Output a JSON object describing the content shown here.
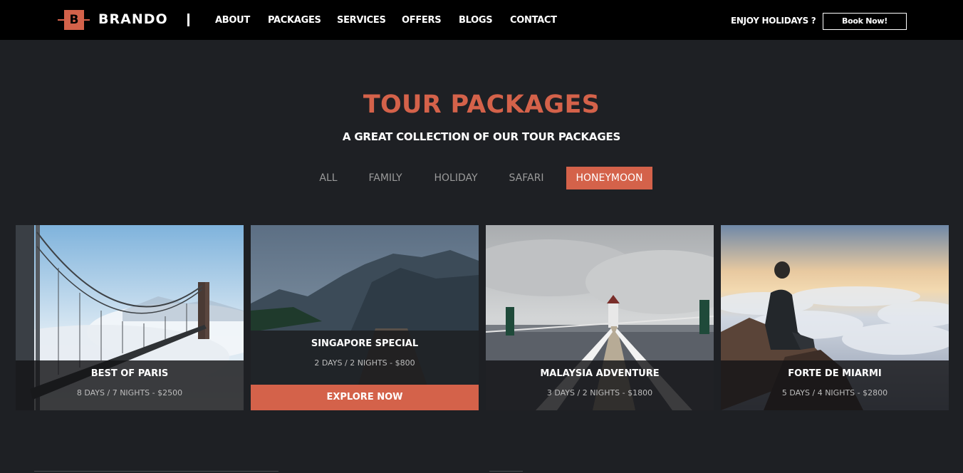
{
  "brand": {
    "mark": "B",
    "name": "BRANDO"
  },
  "nav": {
    "items": [
      "ABOUT",
      "PACKAGES",
      "SERVICES",
      "OFFERS",
      "BLOGS",
      "CONTACT"
    ],
    "tagline": "ENJOY HOLIDAYS ?",
    "cta": "Book Now!"
  },
  "section": {
    "title": "TOUR PACKAGES",
    "subtitle": "A GREAT COLLECTION OF OUR TOUR PACKAGES"
  },
  "filters": {
    "items": [
      "ALL",
      "FAMILY",
      "HOLIDAY",
      "SAFARI",
      "HONEYMOON"
    ],
    "active": "HONEYMOON"
  },
  "packages": [
    {
      "name": "BEST OF PARIS",
      "details": "8 DAYS / 7 NIGHTS - $2500",
      "image": "bridge-in-fog"
    },
    {
      "name": "SINGAPORE SPECIAL",
      "details": "2 DAYS / 2 NIGHTS - $800",
      "image": "mountain-lake",
      "action": "EXPLORE NOW"
    },
    {
      "name": "MALAYSIA ADVENTURE",
      "details": "3 DAYS / 2 NIGHTS - $1800",
      "image": "pier-lighthouse"
    },
    {
      "name": "FORTE DE MIARMI",
      "details": "5 DAYS / 4 NIGHTS - $2800",
      "image": "man-above-clouds"
    }
  ],
  "colors": {
    "accent": "#d4624a",
    "background": "#1e2024",
    "nav": "#000000"
  }
}
